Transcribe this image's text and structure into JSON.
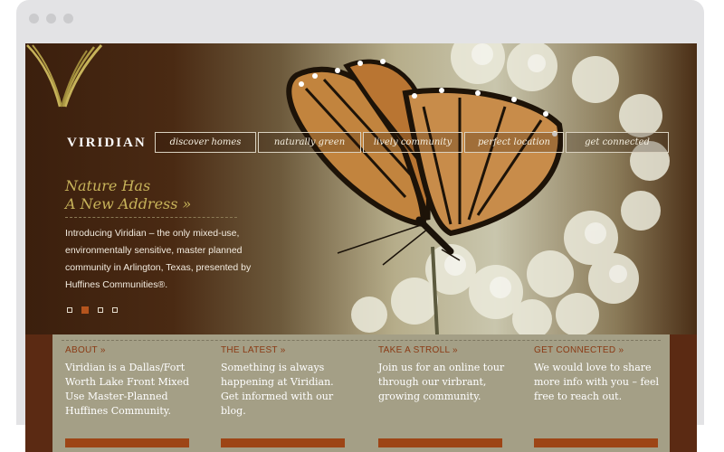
{
  "brand": {
    "name": "VIRIDIAN"
  },
  "nav": [
    {
      "label": "discover homes"
    },
    {
      "label": "naturally green"
    },
    {
      "label": "lively community"
    },
    {
      "label": "perfect location"
    },
    {
      "label": "get connected"
    }
  ],
  "hero": {
    "tagline_line1": "Nature Has",
    "tagline_line2": "A New Address »",
    "intro": "Introducing Viridian – the only mixed-use, environmentally sensitive, master planned community in Arlington, Texas, presented by Huffines Communities®.",
    "slides": 4,
    "active_slide": 2
  },
  "columns": [
    {
      "heading": "ABOUT »",
      "text": "Viridian is a Dallas/Fort Worth Lake Front Mixed Use Master-Planned Huffines Community."
    },
    {
      "heading": "THE LATEST »",
      "text": "Something is always happening at Viridian. Get informed with our blog."
    },
    {
      "heading": "TAKE A STROLL »",
      "text": "Join us for an online tour through our virbrant, growing community."
    },
    {
      "heading": "GET CONNECTED »",
      "text": "We would love to share more info with you – feel free to reach out."
    }
  ],
  "colors": {
    "accent": "#c7b35a",
    "rust": "#9d4516",
    "dark_brown": "#3f220f",
    "panel": "#a49f86"
  }
}
